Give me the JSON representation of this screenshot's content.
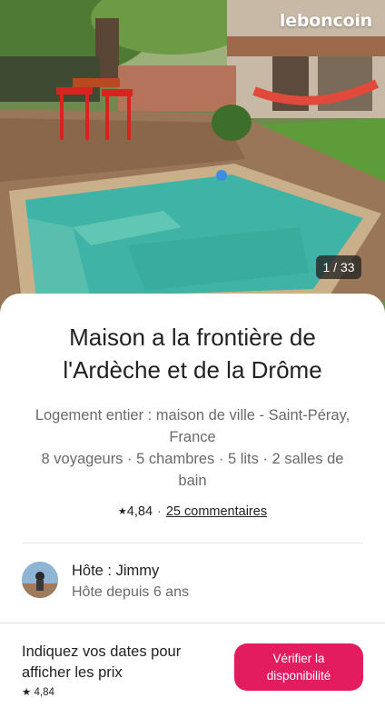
{
  "photo": {
    "watermark": "leboncoin",
    "counter": "1 / 33"
  },
  "listing": {
    "title": "Maison a la frontière de l'Ardèche et de la Drôme",
    "subtitle_line1": "Logement entier : maison de ville - Saint-Péray, France",
    "subtitle_line2": "8 voyageurs · 5 chambres · 5 lits · 2 salles de bain",
    "rating": "4,84",
    "separator": "·",
    "reviews_link": "25 commentaires"
  },
  "host": {
    "name": "Hôte : Jimmy",
    "since": "Hôte depuis 6 ans"
  },
  "booking_bar": {
    "prompt": "Indiquez vos dates pour afficher les prix",
    "rating": "4,84",
    "button_label": "Vérifier la disponibilité"
  },
  "colors": {
    "accent": "#e31c5f",
    "text_primary": "#222222",
    "text_secondary": "#6a6a6a"
  },
  "icons": [
    "star-icon",
    "avatar"
  ]
}
